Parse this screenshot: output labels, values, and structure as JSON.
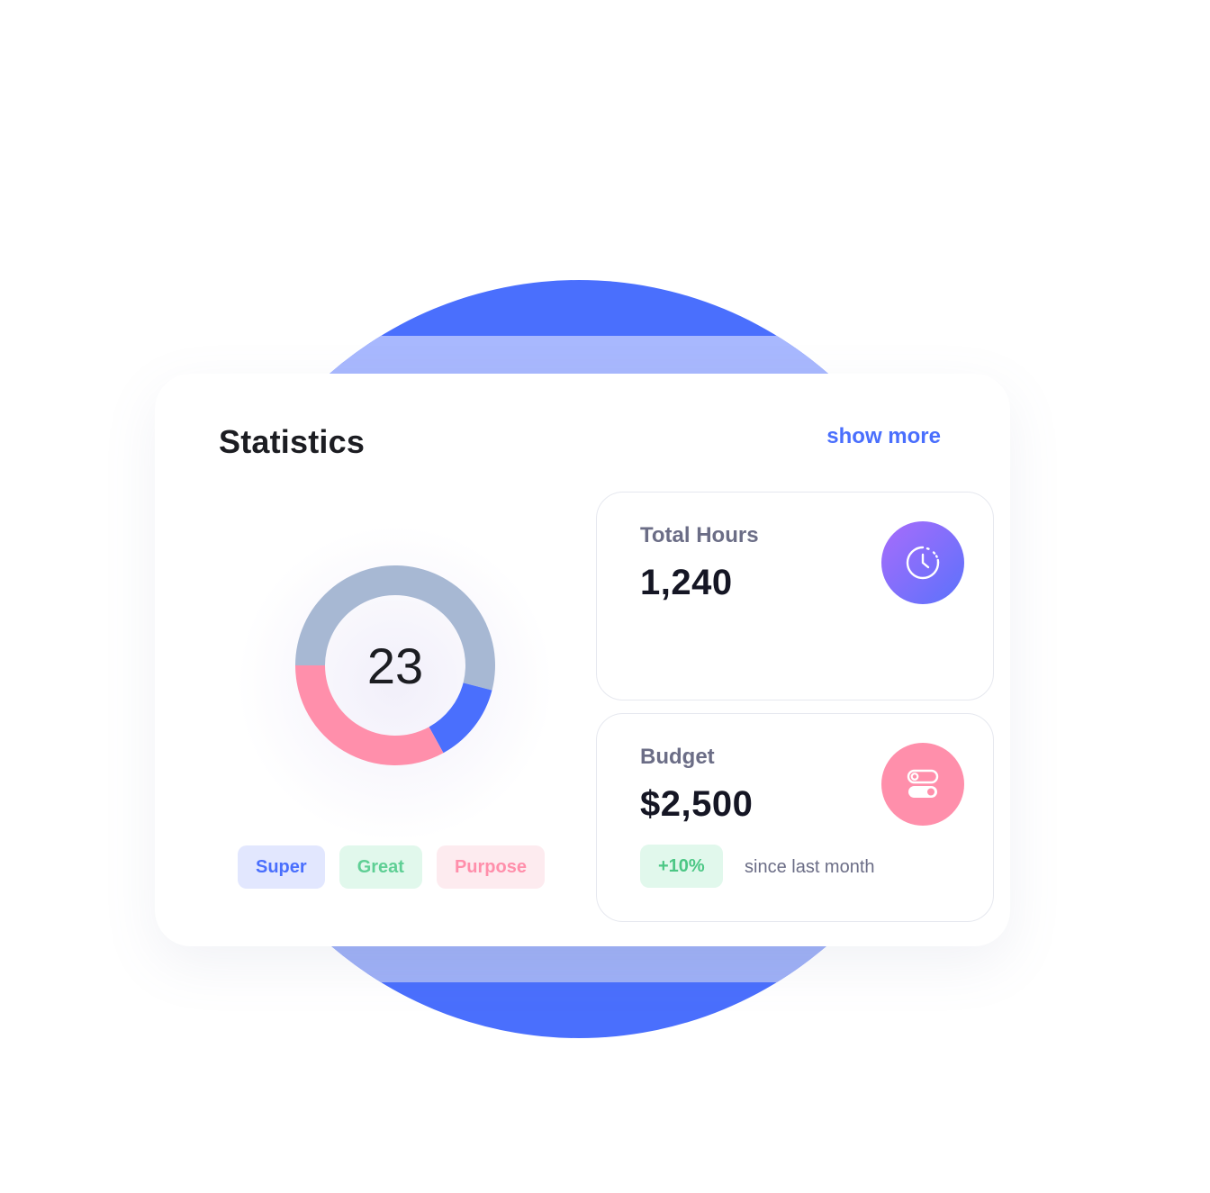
{
  "statistics": {
    "title": "Statistics",
    "show_more_label": "show more"
  },
  "donut": {
    "center_value": "23",
    "segments": [
      {
        "color": "#a7b8d3",
        "fraction": 0.54
      },
      {
        "color": "#4a6ffd",
        "fraction": 0.13
      },
      {
        "color": "#ff8fab",
        "fraction": 0.33
      }
    ]
  },
  "legend": [
    {
      "label": "Super"
    },
    {
      "label": "Great"
    },
    {
      "label": "Purpose"
    }
  ],
  "total_hours": {
    "label": "Total Hours",
    "value": "1,240",
    "icon": "clock-icon"
  },
  "budget": {
    "label": "Budget",
    "value": "$2,500",
    "change": "+10%",
    "change_note": "since last month",
    "icon": "toggle-icon"
  },
  "colors": {
    "accent_blue": "#4a6ffd",
    "pink": "#ff8fab",
    "green": "#5fcf95"
  }
}
